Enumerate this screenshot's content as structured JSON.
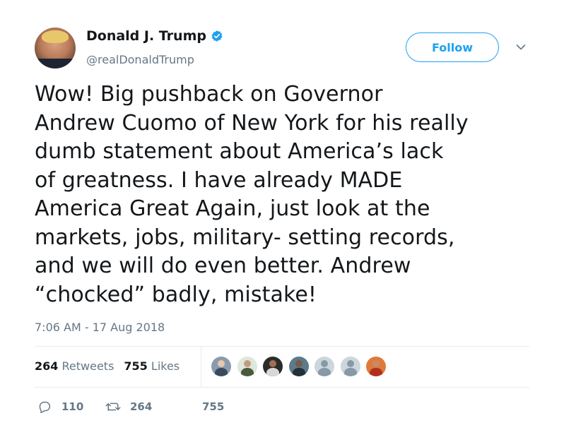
{
  "user": {
    "display_name": "Donald J. Trump",
    "handle": "@realDonaldTrump",
    "verified": true,
    "avatar_icon": "profile-photo"
  },
  "follow_label": "Follow",
  "tweet": {
    "lines": [
      "Wow! Big pushback on Governor",
      "Andrew Cuomo of New York for his really",
      "dumb statement about America’s lack",
      "of greatness. I have already MADE",
      "America Great Again, just look at the",
      "markets, jobs, military- setting records,",
      "and we will do even better. Andrew",
      "“chocked” badly, mistake!"
    ],
    "timestamp": "7:06 AM - 17 Aug 2018"
  },
  "stats": {
    "retweets_count": "264",
    "retweets_label": "Retweets",
    "likes_count": "755",
    "likes_label": "Likes"
  },
  "likers": [
    {
      "icon": "user-avatar-photo",
      "color": "#8a9bb0"
    },
    {
      "icon": "user-avatar-photo",
      "color": "#6f7f5f"
    },
    {
      "icon": "user-avatar-photo",
      "color": "#2b2b2b"
    },
    {
      "icon": "user-avatar-photo",
      "color": "#5c7a8a"
    },
    {
      "icon": "default-user-icon",
      "color": "#ccd6dd"
    },
    {
      "icon": "default-user-icon",
      "color": "#ccd6dd"
    },
    {
      "icon": "user-avatar-photo",
      "color": "#e07a3a"
    }
  ],
  "actions": {
    "replies": "110",
    "retweets": "264",
    "likes": "755"
  },
  "colors": {
    "accent": "#1da1f2",
    "text": "#14171a",
    "muted": "#657786",
    "border": "#e6ecf0"
  }
}
